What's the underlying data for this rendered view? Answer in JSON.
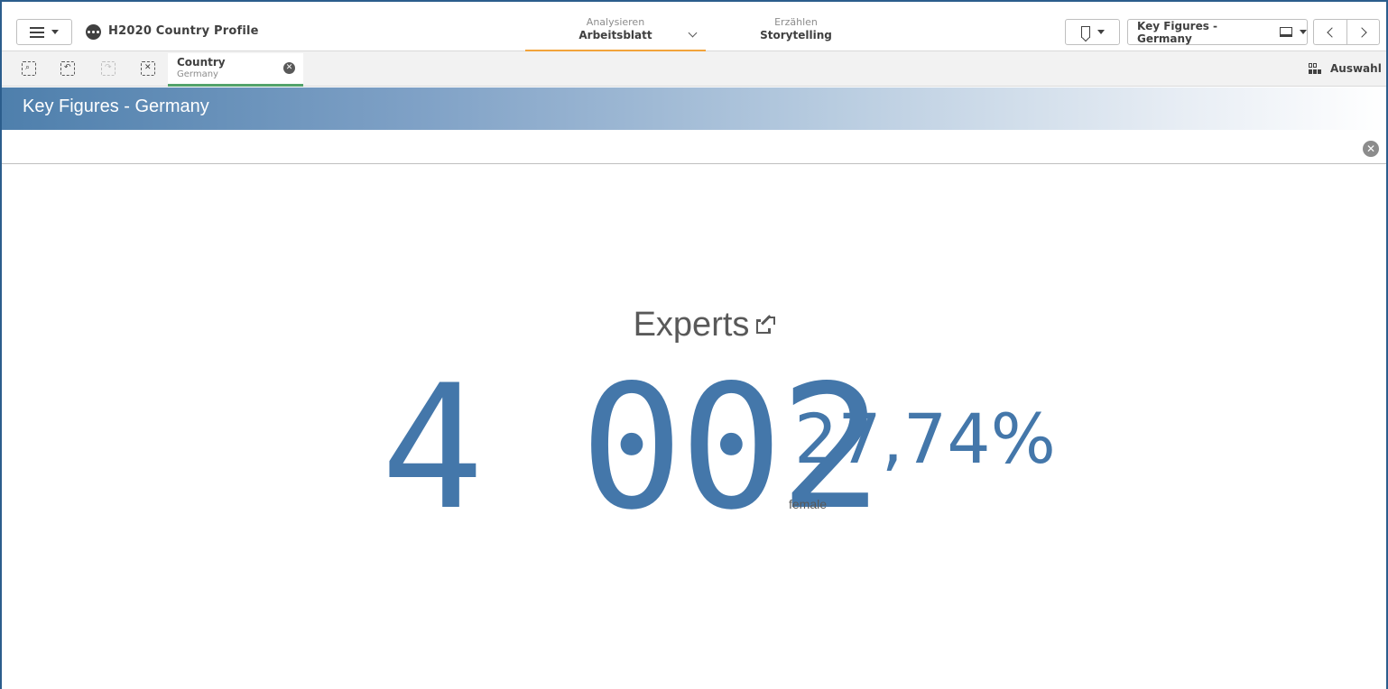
{
  "header": {
    "app_title": "H2020 Country Profile",
    "tabs": [
      {
        "small": "Analysieren",
        "label": "Arbeitsblatt"
      },
      {
        "small": "Erzählen",
        "label": "Storytelling"
      }
    ],
    "sheet_selector_label": "Key Figures - Germany"
  },
  "selections": {
    "field": "Country",
    "value": "Germany",
    "panel_label": "Auswahl"
  },
  "sheet": {
    "title": "Key Figures - Germany"
  },
  "kpi": {
    "title": "Experts",
    "main_value": "4 002",
    "secondary_value": "27,74%",
    "secondary_label": "female",
    "color": "#4477aa"
  },
  "colors": {
    "accent_tab": "#f2a33a",
    "selection_green": "#52a36b",
    "title_band_start": "#4e7fac"
  }
}
